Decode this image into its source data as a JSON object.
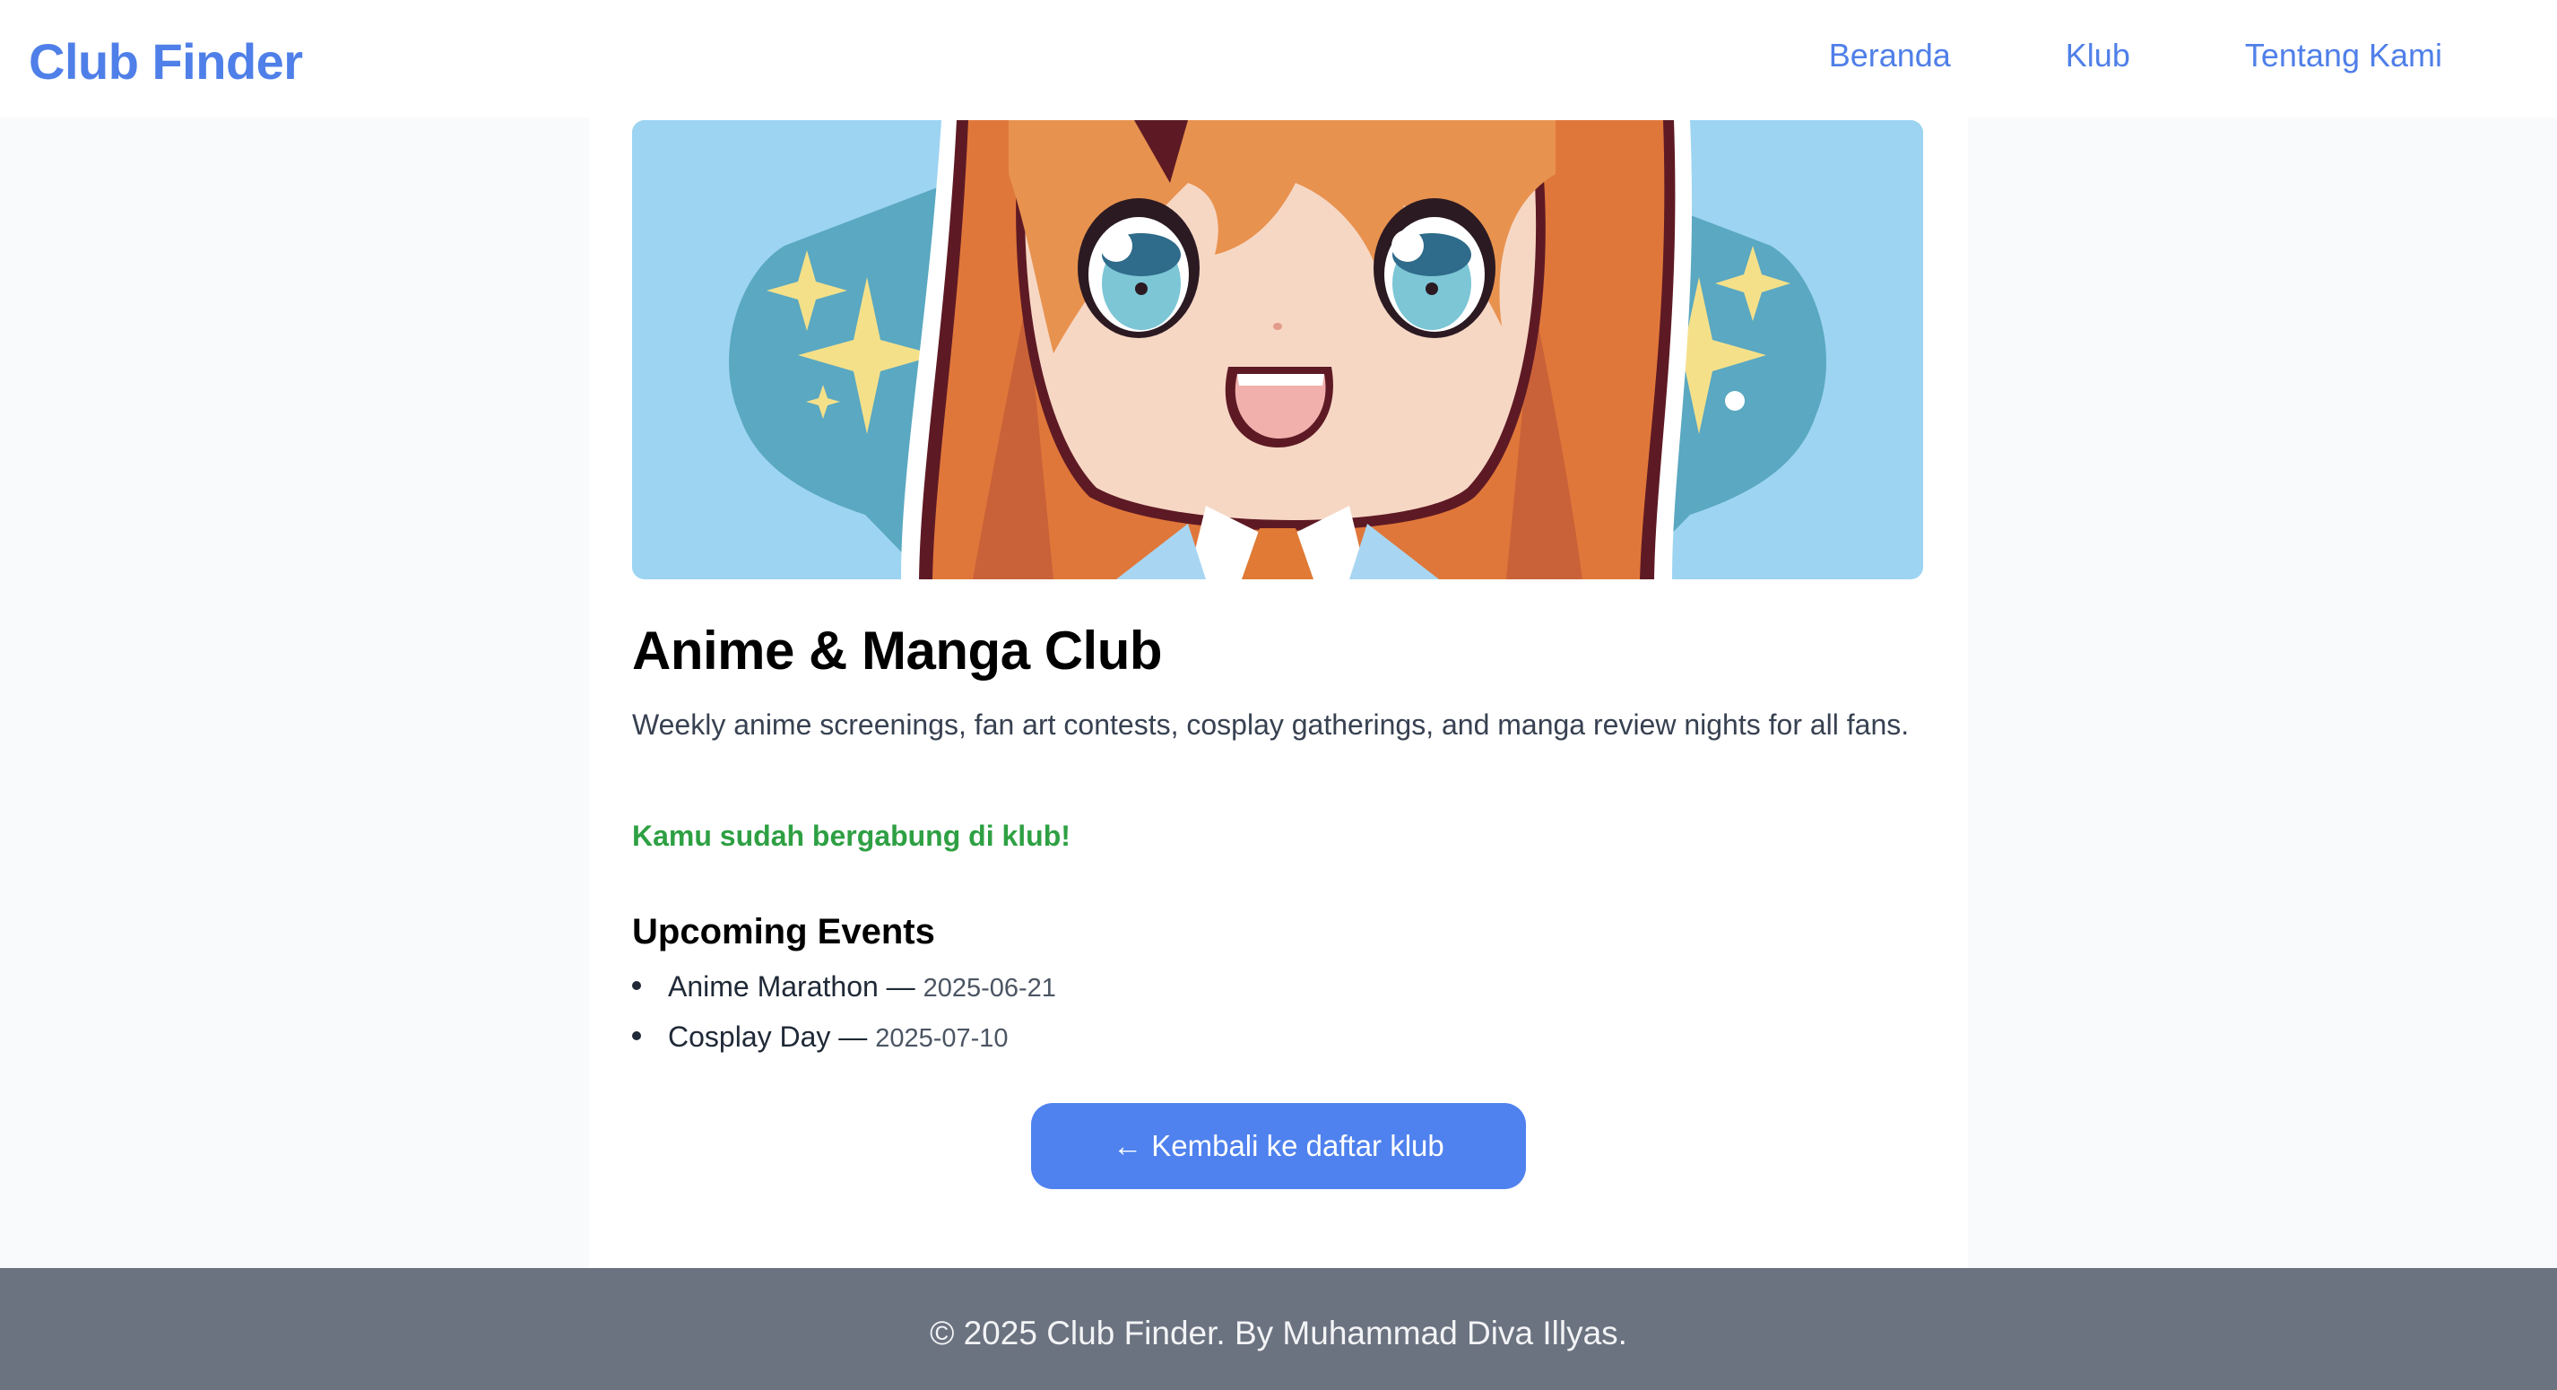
{
  "navbar": {
    "brand": "Club Finder",
    "links": [
      {
        "label": "Beranda"
      },
      {
        "label": "Klub"
      },
      {
        "label": "Tentang Kami"
      }
    ]
  },
  "club": {
    "title": "Anime & Manga Club",
    "description": "Weekly anime screenings, fan art contests, cosplay gatherings, and manga review nights for all fans.",
    "joined_message": "Kamu sudah bergabung di klub!",
    "hero_image": "anime-girl-illustration"
  },
  "events": {
    "heading": "Upcoming Events",
    "items": [
      {
        "name": "Anime Marathon",
        "separator": " — ",
        "date": "2025-06-21"
      },
      {
        "name": "Cosplay Day",
        "separator": " — ",
        "date": "2025-07-10"
      }
    ]
  },
  "back_button": {
    "arrow": "←",
    "label": "Kembali ke daftar klub"
  },
  "footer": {
    "text": "© 2025 Club Finder. By Muhammad Diva Illyas."
  },
  "colors": {
    "accent": "#4f7fe8",
    "button": "#4f82ee",
    "success": "#2ea043",
    "footer_bg": "#6b7280",
    "hero_bg": "#9dd4f2"
  }
}
